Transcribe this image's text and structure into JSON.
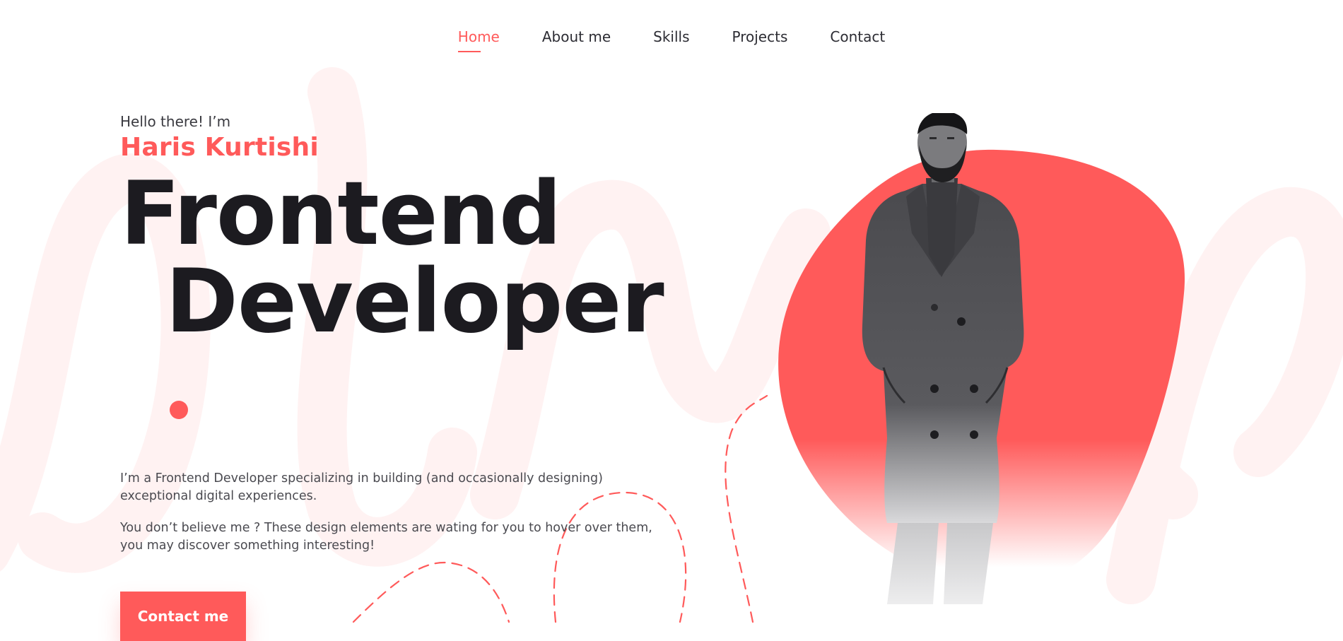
{
  "nav": {
    "items": [
      {
        "label": "Home",
        "active": true
      },
      {
        "label": "About me",
        "active": false
      },
      {
        "label": "Skills",
        "active": false
      },
      {
        "label": "Projects",
        "active": false
      },
      {
        "label": "Contact",
        "active": false
      }
    ]
  },
  "hero": {
    "greeting": "Hello there! I’m",
    "name": "Haris Kurtishi",
    "title_line1": "Frontend",
    "title_line2": "Developer",
    "description_1": "I’m a Frontend Developer specializing in building (and occasionally designing) exceptional digital experiences.",
    "description_2": "You don’t believe me ? These design elements are wating for you to hover over them, you may discover something interesting!",
    "cta_label": "Contact me"
  },
  "colors": {
    "accent": "#ff5a5a",
    "text_dark": "#1c1b20",
    "text_body": "#4a4a50",
    "background": "#ffffff",
    "background_script": "#fff3f3"
  },
  "icons": {
    "scroll_up": "chevron-up-icon"
  }
}
